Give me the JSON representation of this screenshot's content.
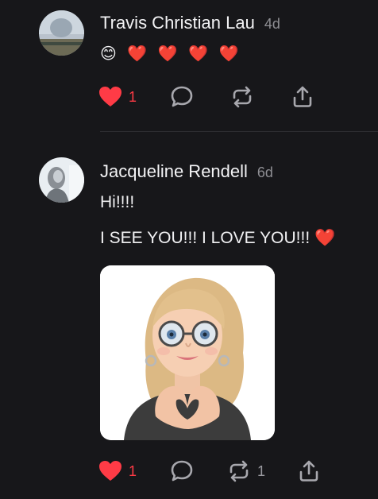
{
  "colors": {
    "background": "#17171a",
    "like_red": "#ff3b46",
    "muted": "#8e8e93",
    "divider": "#2c2c30"
  },
  "posts": [
    {
      "author": "Travis Christian Lau",
      "time": "4d",
      "lines": [
        "😊 ❤️ ❤️ ❤️ ❤️"
      ],
      "likes": "1",
      "reposts": "",
      "liked": true
    },
    {
      "author": "Jacqueline Rendell",
      "time": "6d",
      "lines": [
        "Hi!!!!",
        "I SEE YOU!!! I LOVE YOU!!! ❤️"
      ],
      "likes": "1",
      "reposts": "1",
      "liked": true,
      "attachment": "memoji-heart-hands-image"
    }
  ],
  "icons": {
    "like": "heart-icon",
    "reply": "comment-icon",
    "repost": "repost-icon",
    "share": "share-icon"
  }
}
